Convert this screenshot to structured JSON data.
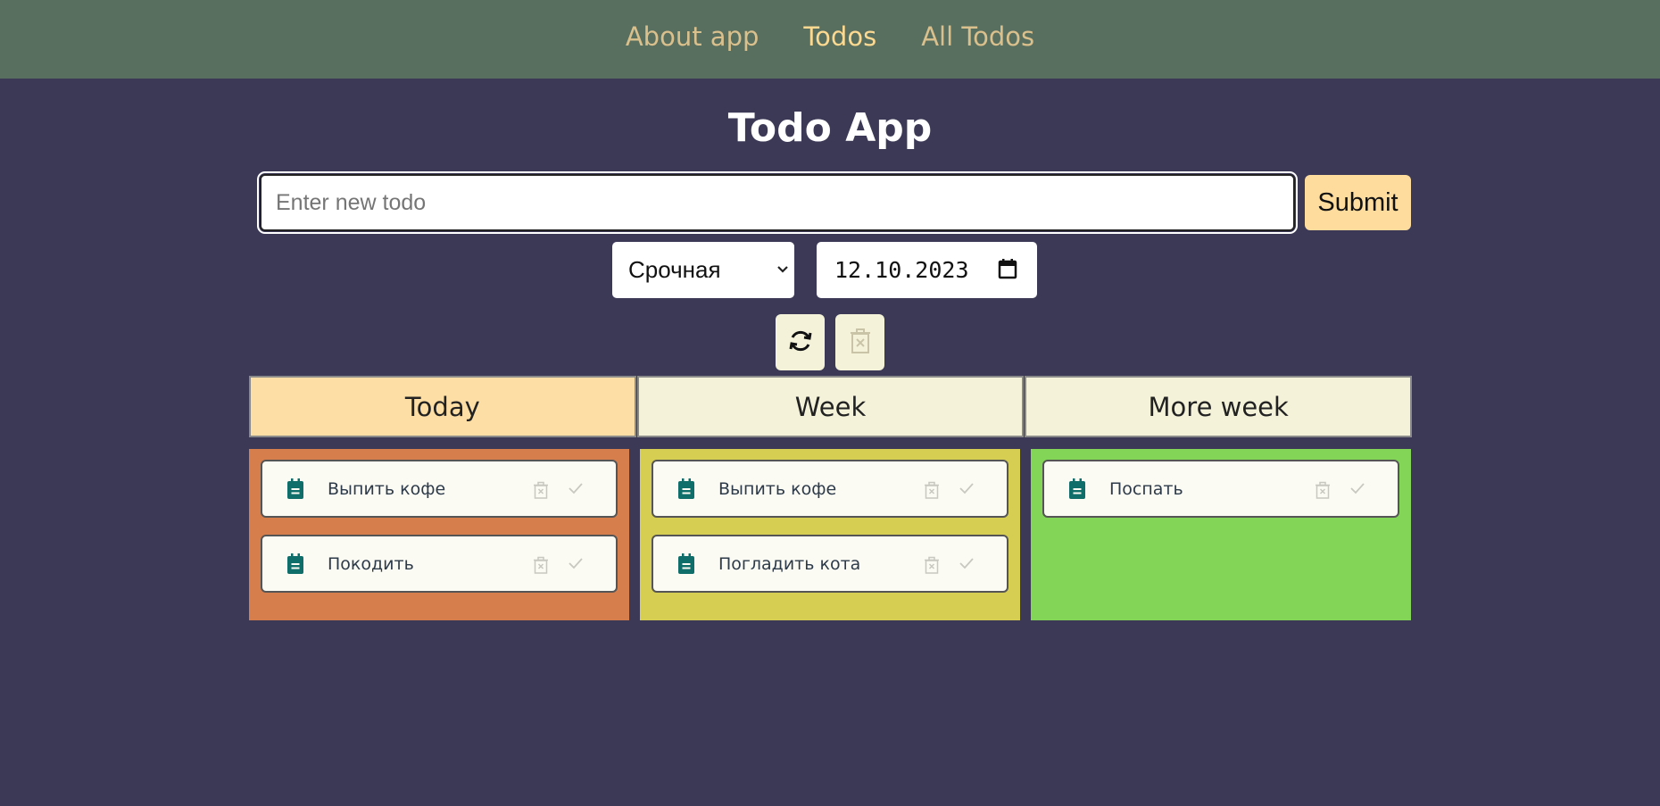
{
  "nav": {
    "items": [
      {
        "label": "About app"
      },
      {
        "label": "Todos"
      },
      {
        "label": "All Todos"
      }
    ]
  },
  "title": "Todo App",
  "form": {
    "input_placeholder": "Enter new todo",
    "input_value": "",
    "submit_label": "Submit",
    "priority_selected": "Срочная",
    "date_value": "12.10.2023"
  },
  "actions": {
    "refresh_icon": "refresh-icon",
    "delete_all_icon": "trash-icon"
  },
  "tabs": [
    {
      "label": "Today"
    },
    {
      "label": "Week"
    },
    {
      "label": "More week"
    }
  ],
  "columns": [
    {
      "color": "#d77e4d",
      "items": [
        {
          "text": "Выпить кофе"
        },
        {
          "text": "Покодить"
        }
      ]
    },
    {
      "color": "#d6cd53",
      "items": [
        {
          "text": "Выпить кофе"
        },
        {
          "text": "Погладить кота"
        }
      ]
    },
    {
      "color": "#83d558",
      "items": [
        {
          "text": "Поспать"
        }
      ]
    }
  ],
  "colors": {
    "background": "#3b3956",
    "nav_background": "#586e5f",
    "accent": "#fddfa5",
    "note_icon": "#0f6e6a"
  }
}
